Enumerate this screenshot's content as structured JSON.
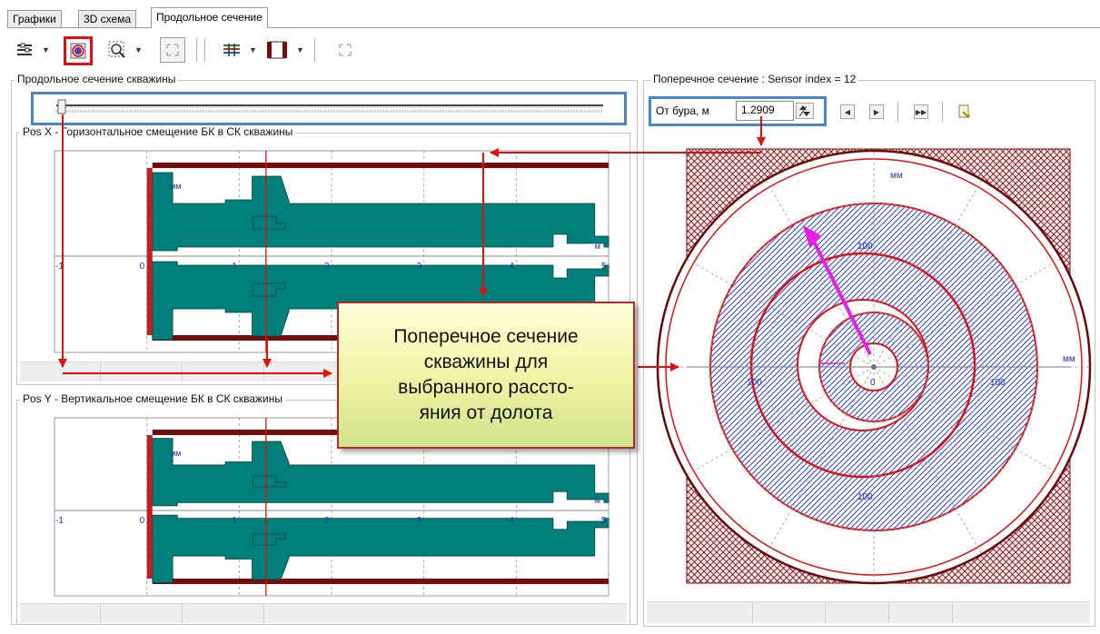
{
  "tabs": [
    {
      "label": "Графики"
    },
    {
      "label": "3D схема"
    },
    {
      "label": "Продольное сечение"
    }
  ],
  "active_tab": "Продольное сечение",
  "toolbar_icons": [
    "layers-icon",
    "cross-section-icon",
    "zoom-icon",
    "fit-icon",
    "pipes-icon",
    "frame-icon",
    "fit-icon"
  ],
  "longitudinal": {
    "title": "Продольное сечение скважины",
    "slider_value": 0
  },
  "pos_x": {
    "title": "Pos X - Горизонтальное смещение БК в СК скважины",
    "unit_v": "мм",
    "unit_h": "м",
    "ticks": [
      "-1",
      "0",
      "1",
      "2",
      "3",
      "4",
      "5"
    ]
  },
  "pos_y": {
    "title": "Pos Y - Вертикальное смещение БК в СК скважины",
    "unit_v": "мм",
    "unit_h": "м",
    "ticks": [
      "-1",
      "0",
      "1",
      "2",
      "3",
      "4",
      "5"
    ]
  },
  "cross_section": {
    "title": "Поперечное сечение : Sensor index = 12",
    "distance_label": "От бура, м",
    "distance_value": "1.2909",
    "unit": "мм",
    "labels": {
      "top": "100",
      "bottom": "100",
      "left": "100",
      "right": "100",
      "center": "0"
    }
  },
  "callout": {
    "lines": [
      "Поперечное сечение",
      "скважины для",
      "выбранного рассто-",
      "яния от долота"
    ]
  },
  "colors": {
    "teal": "#00807a",
    "dark_red": "#7a0c0c",
    "red": "#e01010",
    "blue_hatch": "#2a3fd6",
    "magenta": "#e61ee6",
    "highlight_blue": "#4a86c5"
  }
}
